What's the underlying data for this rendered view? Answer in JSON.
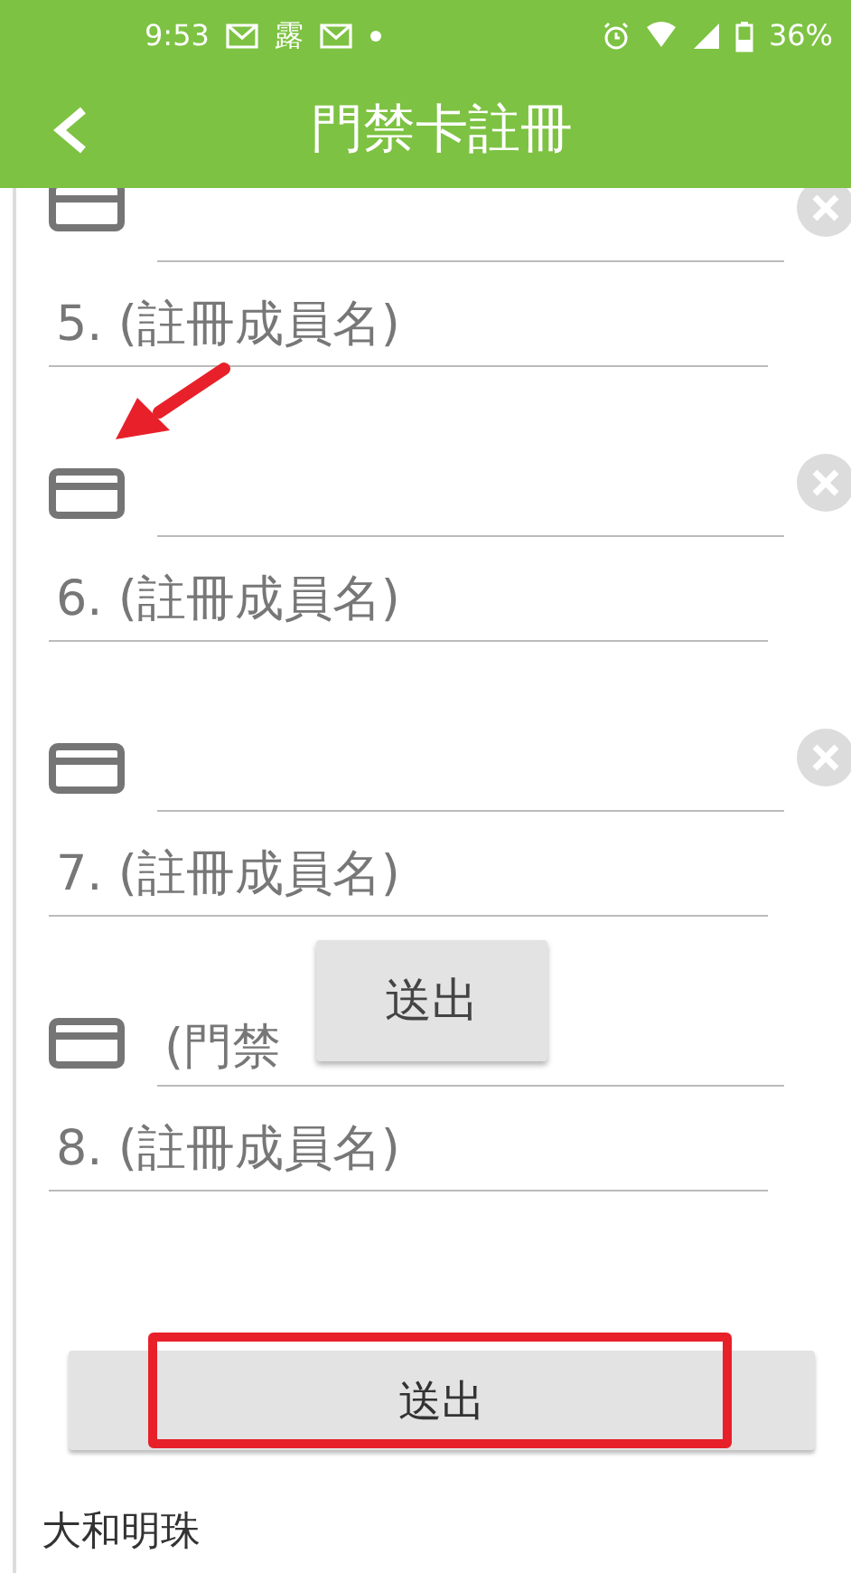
{
  "status_bar": {
    "time": "9:53",
    "notification_text": "露",
    "battery": "36%"
  },
  "header": {
    "title": "門禁卡註冊"
  },
  "members": [
    {
      "kind": "card-only",
      "clearable": true
    },
    {
      "kind": "name-only",
      "name_placeholder": "5. (註冊成員名)"
    },
    {
      "kind": "full",
      "clearable": true,
      "name_placeholder": "6. (註冊成員名)"
    },
    {
      "kind": "full",
      "clearable": true,
      "name_placeholder": "7. (註冊成員名)"
    },
    {
      "kind": "full",
      "card_placeholder": "(門禁",
      "clearable": false,
      "name_placeholder": "8. (註冊成員名)"
    }
  ],
  "floating_button": {
    "label": "送出"
  },
  "submit_button": {
    "label": "送出"
  },
  "footer_text": "大和明珠"
}
